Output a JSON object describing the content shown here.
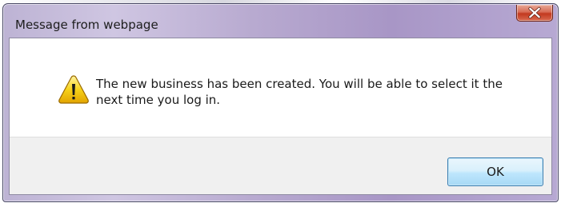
{
  "dialog": {
    "title": "Message from webpage",
    "message": "The new business has been created.  You will be able to select it the next time you log in.",
    "icon": "warning-icon",
    "ok_label": "OK",
    "close_icon": "close-icon"
  },
  "colors": {
    "frame": "#b8aad0",
    "close_button": "#c2391f",
    "ok_button_border": "#3c7fb1",
    "warning_fill": "#f5c200",
    "button_area": "#f0f0f0"
  }
}
